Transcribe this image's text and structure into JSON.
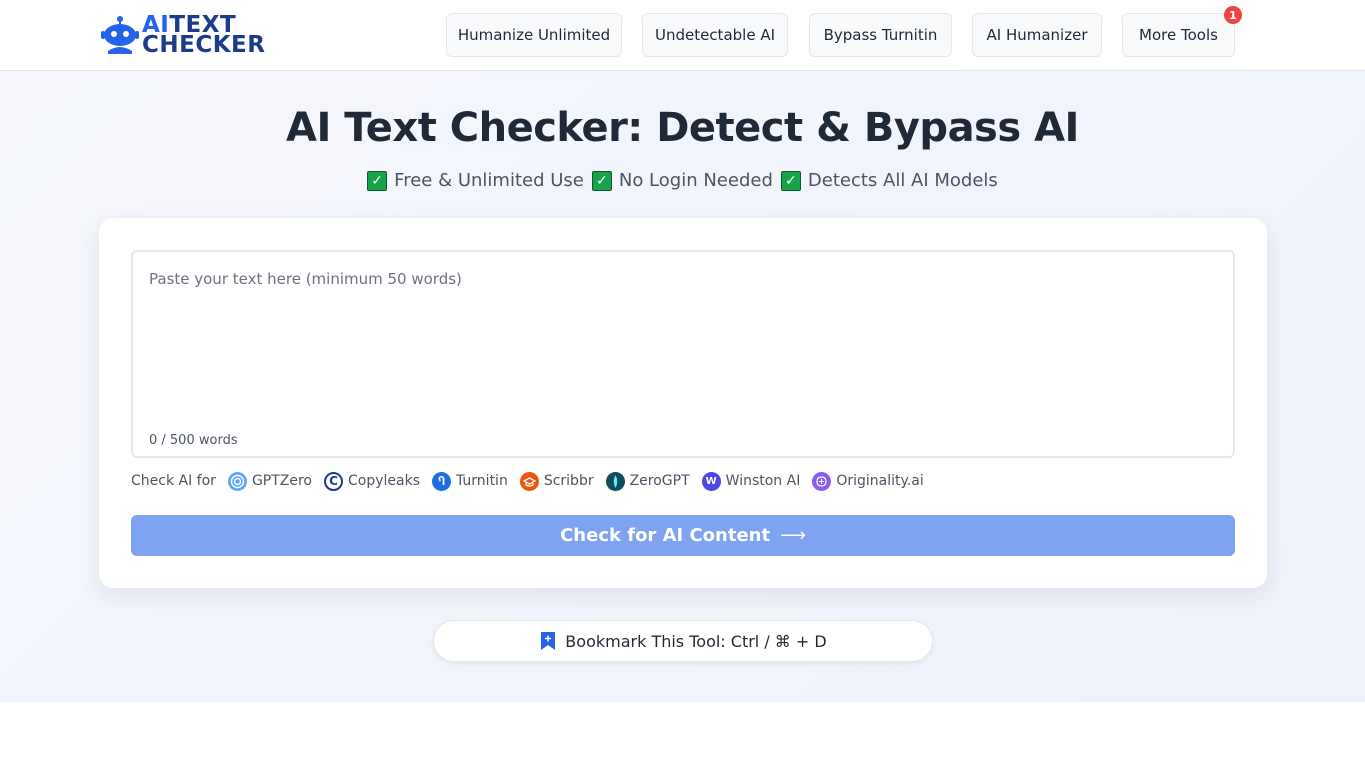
{
  "header": {
    "logo_part1": "AI",
    "logo_part2": "TEXT",
    "logo_line2": "CHECKER",
    "nav": [
      {
        "label": "Humanize Unlimited"
      },
      {
        "label": "Undetectable AI"
      },
      {
        "label": "Bypass Turnitin"
      },
      {
        "label": "AI Humanizer"
      },
      {
        "label": "More Tools",
        "badge": "1"
      }
    ]
  },
  "hero": {
    "title": "AI Text Checker: Detect & Bypass AI",
    "features": [
      "Free & Unlimited Use",
      "No Login Needed",
      "Detects All AI Models"
    ],
    "check_mark": "✓"
  },
  "checker": {
    "placeholder": "Paste your text here (minimum 50 words)",
    "word_count": "0 / 500 words",
    "check_for_label": "Check AI for",
    "detectors": [
      {
        "name": "GPTZero",
        "icon": "gptzero-icon",
        "color": "#3b82f6"
      },
      {
        "name": "Copyleaks",
        "icon": "copyleaks-icon",
        "color": "#1e3a8a"
      },
      {
        "name": "Turnitin",
        "icon": "turnitin-icon",
        "color": "#1d4ed8"
      },
      {
        "name": "Scribbr",
        "icon": "scribbr-icon",
        "color": "#ea580c"
      },
      {
        "name": "ZeroGPT",
        "icon": "zerogpt-icon",
        "color": "#0f4c5c"
      },
      {
        "name": "Winston AI",
        "icon": "winston-icon",
        "color": "#4f46e5"
      },
      {
        "name": "Originality.ai",
        "icon": "originality-icon",
        "color": "#8b5cf6"
      }
    ],
    "button_label": "Check for AI Content",
    "button_arrow": "⟶"
  },
  "bookmark": {
    "label": "Bookmark This Tool: Ctrl / ⌘ + D"
  },
  "colors": {
    "primary": "#2563eb",
    "button": "#7ea3f0",
    "badge": "#ef4444",
    "check": "#16a34a"
  }
}
